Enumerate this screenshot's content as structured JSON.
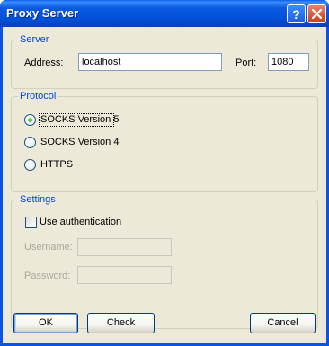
{
  "window": {
    "title": "Proxy Server"
  },
  "server": {
    "group_label": "Server",
    "address_label": "Address:",
    "address_value": "localhost",
    "port_label": "Port:",
    "port_value": "1080"
  },
  "protocol": {
    "group_label": "Protocol",
    "options": [
      {
        "label": "SOCKS Version 5",
        "selected": true
      },
      {
        "label": "SOCKS Version 4",
        "selected": false
      },
      {
        "label": "HTTPS",
        "selected": false
      }
    ]
  },
  "settings": {
    "group_label": "Settings",
    "auth_label": "Use authentication",
    "auth_checked": false,
    "username_label": "Username:",
    "username_value": "",
    "password_label": "Password:",
    "password_value": ""
  },
  "buttons": {
    "ok": "OK",
    "check": "Check",
    "cancel": "Cancel"
  }
}
